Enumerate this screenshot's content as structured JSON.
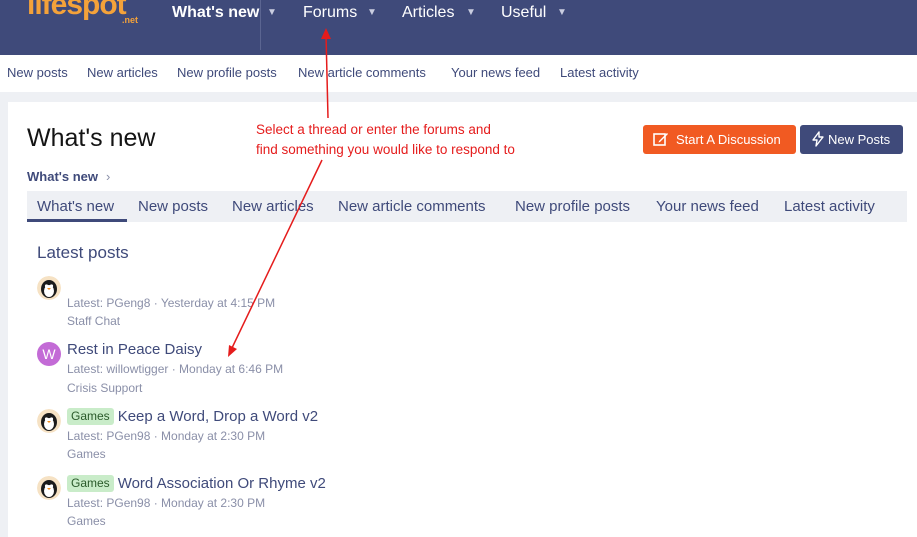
{
  "brand": {
    "logo_text": "lifespot",
    "logo_sub": ".net",
    "logo_color": "#f4a23a"
  },
  "colors": {
    "nav_bg": "#3f4a7a",
    "accent_orange": "#f15a22",
    "annotation_red": "#e51c1c"
  },
  "top_nav": [
    {
      "label": "What's new"
    },
    {
      "label": "Forums"
    },
    {
      "label": "Articles"
    },
    {
      "label": "Useful"
    }
  ],
  "sub_nav": [
    "New posts",
    "New articles",
    "New profile posts",
    "New article comments",
    "Your news feed",
    "Latest activity"
  ],
  "page": {
    "title": "What's new",
    "breadcrumb": "What's new",
    "start_discussion_label": "Start A Discussion",
    "new_posts_label": "New Posts"
  },
  "tabs": [
    "What's new",
    "New posts",
    "New articles",
    "New article comments",
    "New profile posts",
    "Your news feed",
    "Latest activity"
  ],
  "latest_posts": {
    "heading": "Latest posts",
    "items": [
      {
        "title": "",
        "prefix": "",
        "meta": "Latest: PGeng8 · Yesterday at 4:15 PM",
        "forum": "Staff Chat",
        "avatar": "penguin-avatar"
      },
      {
        "title": "Rest in Peace Daisy",
        "prefix": "",
        "meta": "Latest: willowtigger · Monday at 6:46 PM",
        "forum": "Crisis Support",
        "avatar_letter": "W"
      },
      {
        "title": "Keep a Word, Drop a Word v2",
        "prefix": "Games",
        "meta": "Latest: PGen98 · Monday at 2:30 PM",
        "forum": "Games",
        "avatar": "penguin-avatar"
      },
      {
        "title": "Word Association Or Rhyme v2",
        "prefix": "Games",
        "meta": "Latest: PGen98 · Monday at 2:30 PM",
        "forum": "Games",
        "avatar": "penguin-avatar"
      }
    ]
  },
  "annotation": {
    "line1": "Select a thread or enter the forums and",
    "line2": "find something you would like to respond to"
  },
  "icons": {
    "nav_dropdown": "chevron-down-icon",
    "breadcrumb_sep": "chevron-right-icon",
    "start_discussion": "edit-icon",
    "new_posts": "bolt-icon"
  }
}
